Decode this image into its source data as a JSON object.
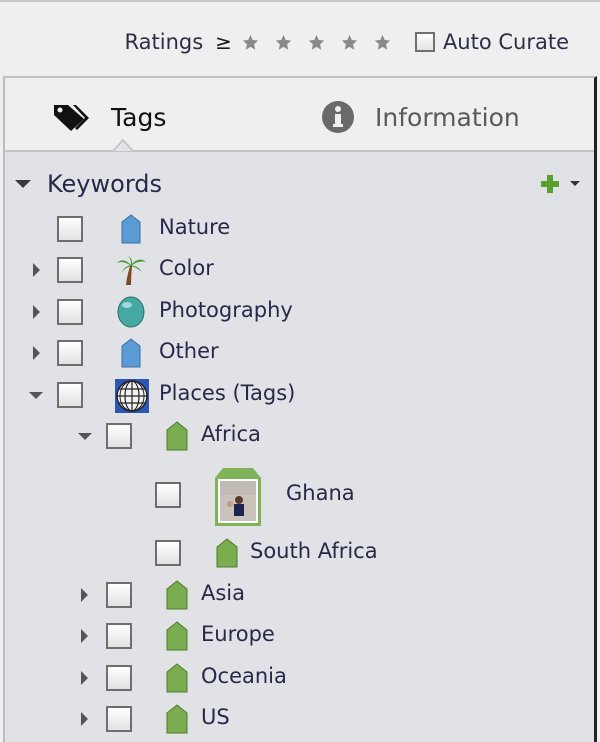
{
  "filter_bar": {
    "ratings_label": "Ratings",
    "ratings_operator": "≥",
    "ratings_stars_total": 5,
    "ratings_stars_selected": 0,
    "auto_curate_label": "Auto Curate",
    "auto_curate_checked": false
  },
  "tabs": [
    {
      "label": "Tags",
      "icon": "tag-icon",
      "active": true
    },
    {
      "label": "Information",
      "icon": "info-icon",
      "active": false
    }
  ],
  "keywords": {
    "header": "Keywords",
    "add_icon": "plus-icon",
    "items": [
      {
        "label": "Nature",
        "icon": "blue-tag-icon",
        "expandable": false,
        "expanded": false,
        "checked": false,
        "level": 0
      },
      {
        "label": "Color",
        "icon": "palm-tree-icon",
        "expandable": true,
        "expanded": false,
        "checked": false,
        "level": 0
      },
      {
        "label": "Photography",
        "icon": "teal-oval-icon",
        "expandable": true,
        "expanded": false,
        "checked": false,
        "level": 0
      },
      {
        "label": "Other",
        "icon": "blue-tag-icon",
        "expandable": true,
        "expanded": false,
        "checked": false,
        "level": 0
      },
      {
        "label": "Places (Tags)",
        "icon": "globe-icon",
        "expandable": true,
        "expanded": true,
        "checked": false,
        "level": 0
      },
      {
        "label": "Africa",
        "icon": "green-tag-icon",
        "expandable": true,
        "expanded": true,
        "checked": false,
        "level": 1
      },
      {
        "label": "Ghana",
        "icon": "photo-tag-thumbnail",
        "expandable": false,
        "expanded": false,
        "checked": false,
        "level": 2
      },
      {
        "label": "South Africa",
        "icon": "green-tag-icon",
        "expandable": false,
        "expanded": false,
        "checked": false,
        "level": 2
      },
      {
        "label": "Asia",
        "icon": "green-tag-icon",
        "expandable": true,
        "expanded": false,
        "checked": false,
        "level": 1
      },
      {
        "label": "Europe",
        "icon": "green-tag-icon",
        "expandable": true,
        "expanded": false,
        "checked": false,
        "level": 1
      },
      {
        "label": "Oceania",
        "icon": "green-tag-icon",
        "expandable": true,
        "expanded": false,
        "checked": false,
        "level": 1
      },
      {
        "label": "US",
        "icon": "green-tag-icon",
        "expandable": true,
        "expanded": false,
        "checked": false,
        "level": 1
      }
    ]
  },
  "colors": {
    "blue_tag": "#5b9bd5",
    "green_tag": "#79ad4f",
    "teal_oval": "#46a8a3",
    "add_green": "#5aa02c"
  }
}
